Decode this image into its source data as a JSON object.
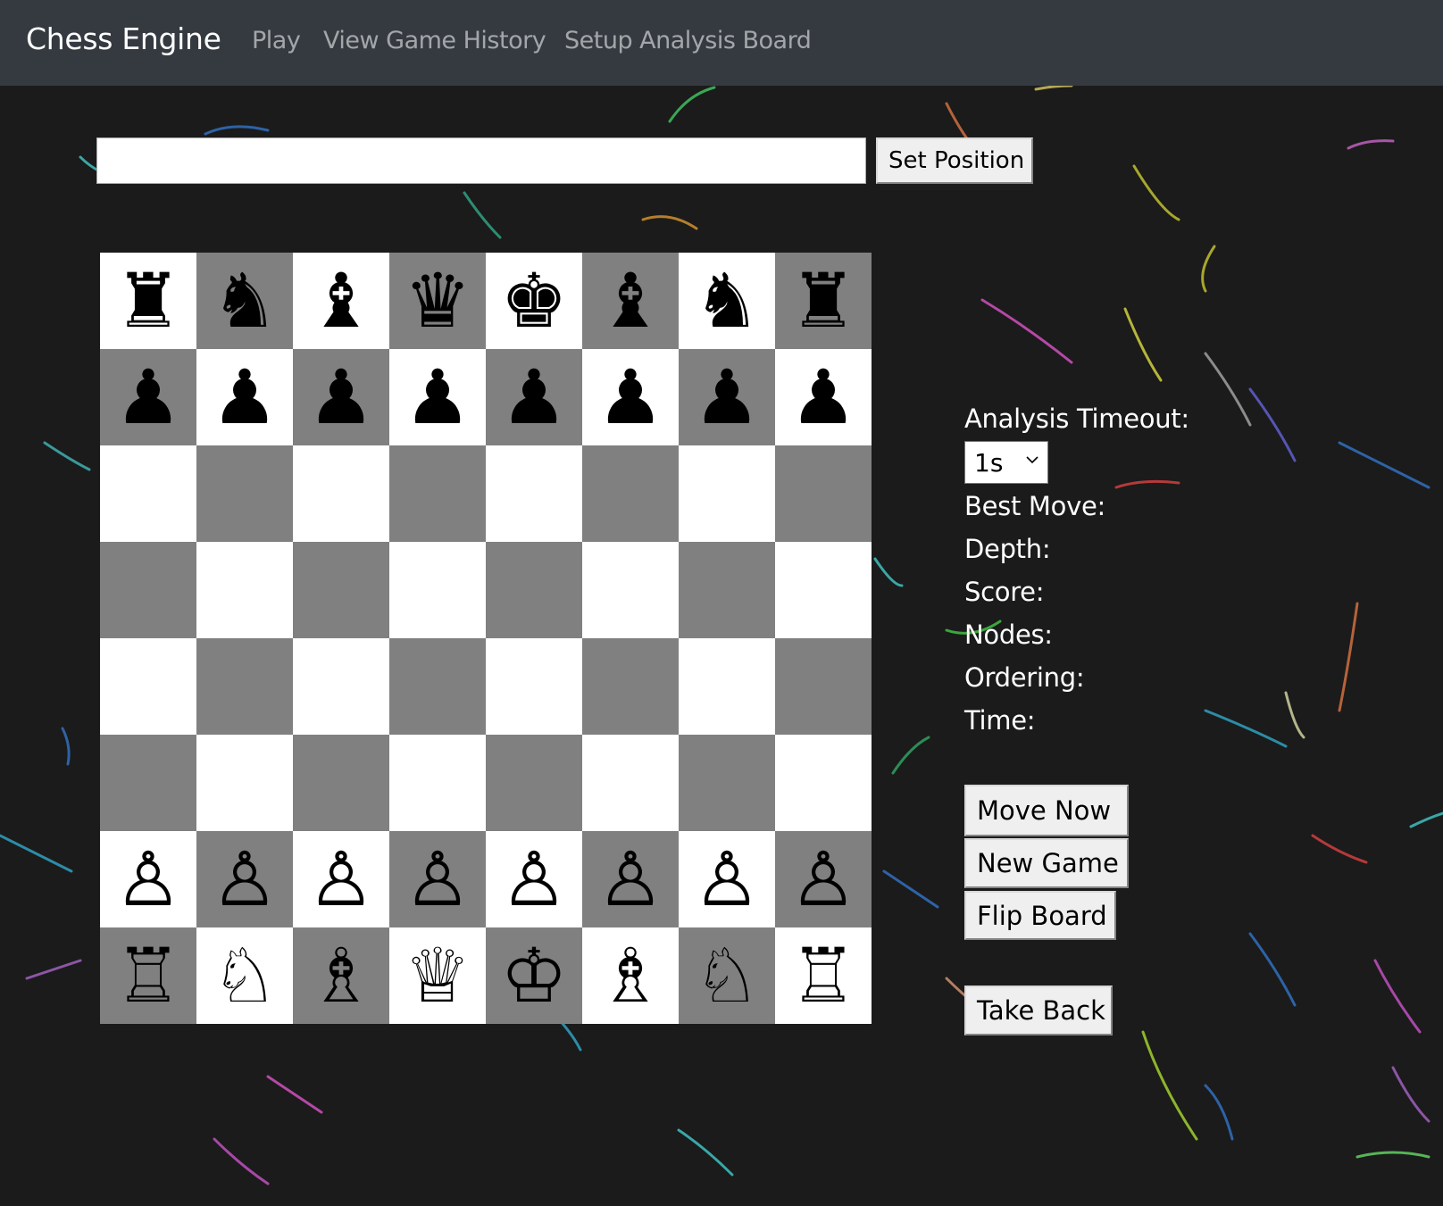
{
  "navbar": {
    "brand": "Chess Engine",
    "links": [
      "Play",
      "View Game History",
      "Setup Analysis Board"
    ]
  },
  "position": {
    "fen_value": "",
    "set_button": "Set Position"
  },
  "board": {
    "light_color": "#ffffff",
    "dark_color": "#808080",
    "pieces": [
      [
        "♜",
        "♞",
        "♝",
        "♛",
        "♚",
        "♝",
        "♞",
        "♜"
      ],
      [
        "♟",
        "♟",
        "♟",
        "♟",
        "♟",
        "♟",
        "♟",
        "♟"
      ],
      [
        "",
        "",
        "",
        "",
        "",
        "",
        "",
        ""
      ],
      [
        "",
        "",
        "",
        "",
        "",
        "",
        "",
        ""
      ],
      [
        "",
        "",
        "",
        "",
        "",
        "",
        "",
        ""
      ],
      [
        "",
        "",
        "",
        "",
        "",
        "",
        "",
        ""
      ],
      [
        "♙",
        "♙",
        "♙",
        "♙",
        "♙",
        "♙",
        "♙",
        "♙"
      ],
      [
        "♖",
        "♘",
        "♗",
        "♕",
        "♔",
        "♗",
        "♘",
        "♖"
      ]
    ]
  },
  "analysis": {
    "timeout_label": "Analysis Timeout:",
    "timeout_value": "1s",
    "best_move_label": "Best Move:",
    "depth_label": "Depth:",
    "score_label": "Score:",
    "nodes_label": "Nodes:",
    "ordering_label": "Ordering:",
    "time_label": "Time:"
  },
  "buttons": {
    "move_now": "Move Now",
    "new_game": "New Game",
    "flip_board": "Flip Board",
    "take_back": "Take Back"
  }
}
